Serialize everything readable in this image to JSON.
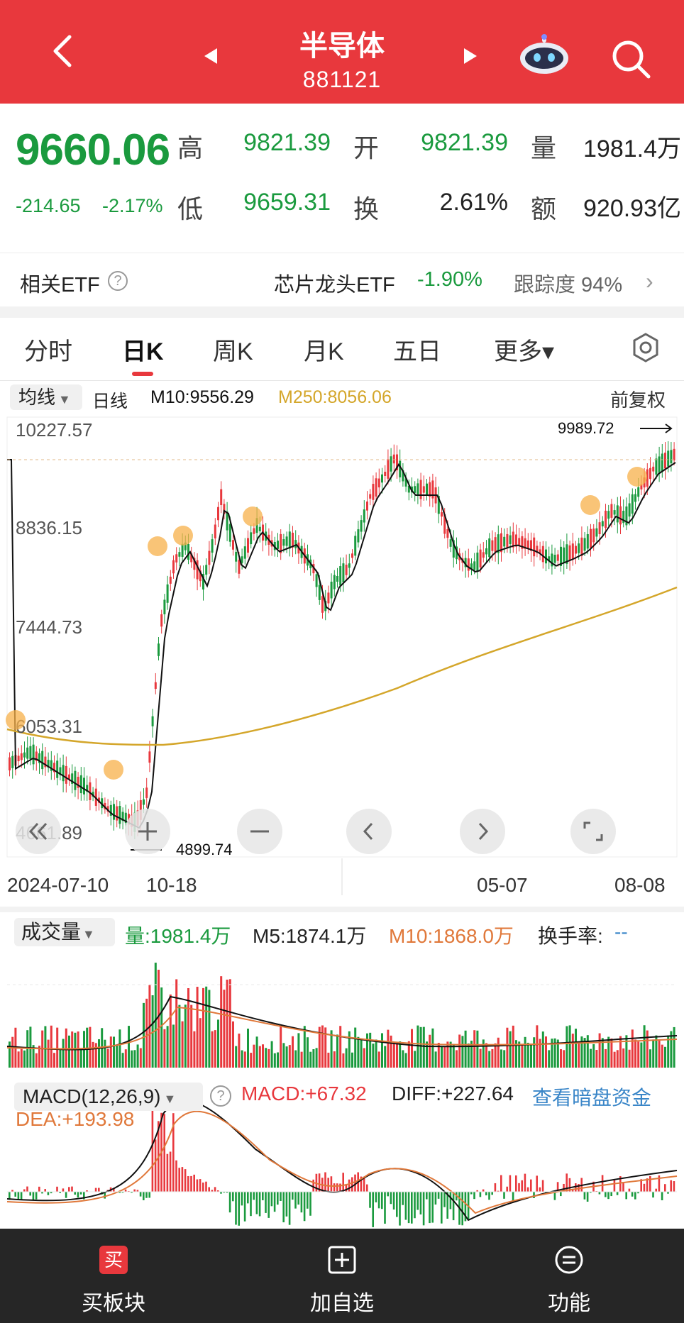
{
  "header": {
    "title": "半导体",
    "code": "881121",
    "icons": [
      "back-icon",
      "prev-arrow-icon",
      "next-arrow-icon",
      "robot-icon",
      "search-icon"
    ],
    "bg_color": "#e8383d"
  },
  "quote": {
    "price": "9660.06",
    "change": "-214.65",
    "change_pct": "-2.17%",
    "high_label": "高",
    "high": "9821.39",
    "open_label": "开",
    "open": "9821.39",
    "volume_label": "量",
    "volume": "1981.4万",
    "low_label": "低",
    "low": "9659.31",
    "turnover_label": "换",
    "turnover": "2.61%",
    "amount_label": "额",
    "amount": "920.93亿"
  },
  "etf": {
    "label": "相关ETF",
    "help": "?",
    "name": "芯片龙头ETF",
    "change": "-1.90%",
    "tracking": "跟踪度 94%",
    "arrow": "›"
  },
  "tabs": [
    {
      "label": "分时"
    },
    {
      "label": "日K",
      "active": true
    },
    {
      "label": "周K"
    },
    {
      "label": "月K"
    },
    {
      "label": "五日"
    },
    {
      "label": "更多▾"
    }
  ],
  "kline": {
    "ma_selector": "均线",
    "period": "日线",
    "m10": "M10:9556.29",
    "m250": "M250:8056.06",
    "adjust": "前复权",
    "y_ticks": [
      "10227.57",
      "8836.15",
      "7444.73",
      "6053.31",
      "4661.89"
    ],
    "high_marker": "9989.72",
    "low_marker": "4899.74",
    "dates": [
      "2024-07-10",
      "10-18",
      "05-07",
      "08-08"
    ],
    "colors": {
      "up": "#e8383d",
      "down": "#1a9a3e",
      "ma10": "#111111",
      "ma250": "#d4a62a"
    }
  },
  "volume": {
    "selector": "成交量",
    "vol": "量:1981.4万",
    "m5": "M5:1874.1万",
    "m10": "M10:1868.0万",
    "turnover_rate": "换手率:",
    "turnover_rate_value": "--"
  },
  "macd": {
    "selector": "MACD(12,26,9)",
    "help": "?",
    "macd": "MACD:+67.32",
    "diff": "DIFF:+227.64",
    "link": "查看暗盘资金",
    "dea": "DEA:+193.98"
  },
  "bottom_bar": {
    "buy": "买板块",
    "buy_icon_char": "买",
    "add": "加自选",
    "func": "功能"
  }
}
